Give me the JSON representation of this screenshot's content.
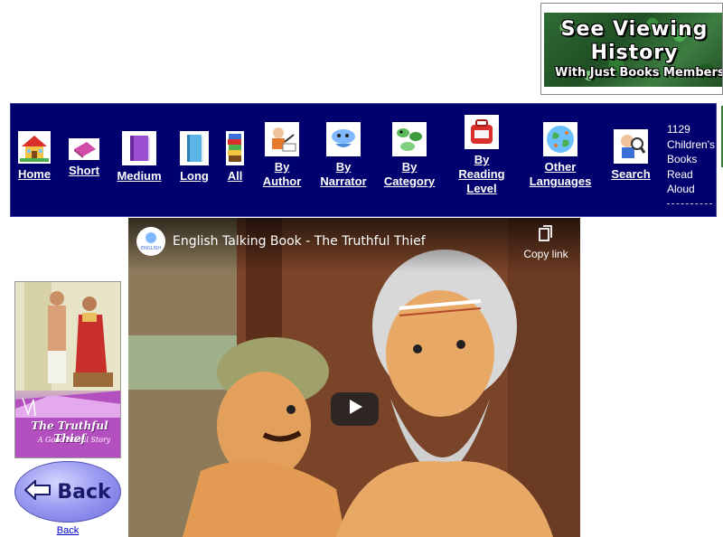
{
  "banner": {
    "line1": "See Viewing",
    "line2": "History",
    "line3": "With Just Books Members"
  },
  "nav": {
    "items": [
      {
        "label": "Home",
        "icon": "house-icon"
      },
      {
        "label": "Short",
        "icon": "short-book-icon"
      },
      {
        "label": "Medium",
        "icon": "medium-book-icon"
      },
      {
        "label": "Long",
        "icon": "long-book-icon"
      },
      {
        "label": "All",
        "icon": "book-stack-icon"
      },
      {
        "label": "By Author",
        "line1": "By",
        "line2": "Author",
        "icon": "author-icon"
      },
      {
        "label": "By Narrator",
        "line1": "By",
        "line2": "Narrator",
        "icon": "narrator-icon"
      },
      {
        "label": "By Category",
        "line1": "By",
        "line2": "Category",
        "icon": "category-icon"
      },
      {
        "label": "By Reading Level",
        "line1": "By",
        "line2": "Reading",
        "line3": "Level",
        "icon": "reading-level-icon"
      },
      {
        "label": "Other Languages",
        "line1": "Other",
        "line2": "Languages",
        "icon": "globe-icon"
      },
      {
        "label": "Search",
        "icon": "search-icon"
      }
    ],
    "stat_lines": [
      "1129",
      "Children's",
      "Books",
      "Read",
      "Aloud"
    ]
  },
  "book": {
    "title": "The Truthful Thief",
    "subtitle": "A Good Moral Story"
  },
  "back": {
    "button_label": "Back",
    "link_label": "Back"
  },
  "video": {
    "title": "English Talking Book - The Truthful Thief",
    "copy_link_label": "Copy link",
    "logo_text": "ENGLISH"
  },
  "colors": {
    "nav_bg": "#00006e",
    "link": "#0000cc",
    "book_accent": "#b44fbf"
  }
}
